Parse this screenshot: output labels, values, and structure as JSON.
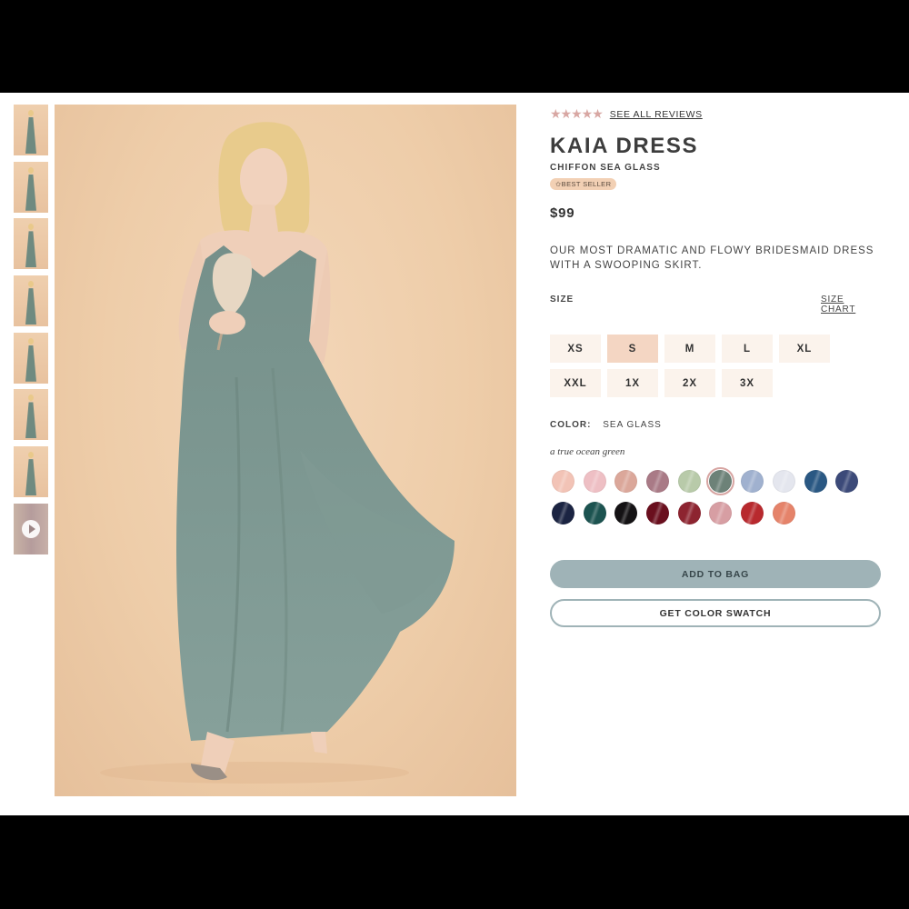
{
  "reviews": {
    "stars": "★★★★★",
    "link_label": "SEE ALL REVIEWS"
  },
  "product": {
    "title": "KAIA DRESS",
    "subtitle": "CHIFFON SEA GLASS",
    "badge": "✩BEST SELLER",
    "price": "$99",
    "description": "OUR MOST DRAMATIC AND FLOWY BRIDESMAID DRESS WITH A SWOOPING SKIRT."
  },
  "size": {
    "label": "SIZE",
    "chart_link": "SIZE CHART",
    "options": [
      "XS",
      "S",
      "M",
      "L",
      "XL",
      "XXL",
      "1X",
      "2X",
      "3X"
    ],
    "selected": "S"
  },
  "color": {
    "label": "COLOR:",
    "value": "SEA GLASS",
    "tagline": "a true ocean green",
    "swatches": [
      "#f2c3b6",
      "#eebfc4",
      "#dba79a",
      "#a97a86",
      "#b8caa9",
      "#6d8278",
      "#a0b1cf",
      "#e4e6ee",
      "#2a5883",
      "#3c4a79",
      "#1b2442",
      "#1c5350",
      "#141214",
      "#6a0f1e",
      "#8d2430",
      "#d79ea3",
      "#b8292e",
      "#e5836a"
    ],
    "selected_index": 5
  },
  "actions": {
    "add_to_bag": "ADD TO BAG",
    "get_swatch": "GET COLOR SWATCH"
  },
  "thumbnails": {
    "count": 8,
    "video_icon": "play-icon"
  },
  "colors": {
    "accent": "#9fb3b7",
    "selected_size": "#f4d6c3",
    "badge": "#f2d0b4",
    "star": "#d8a7a3"
  }
}
